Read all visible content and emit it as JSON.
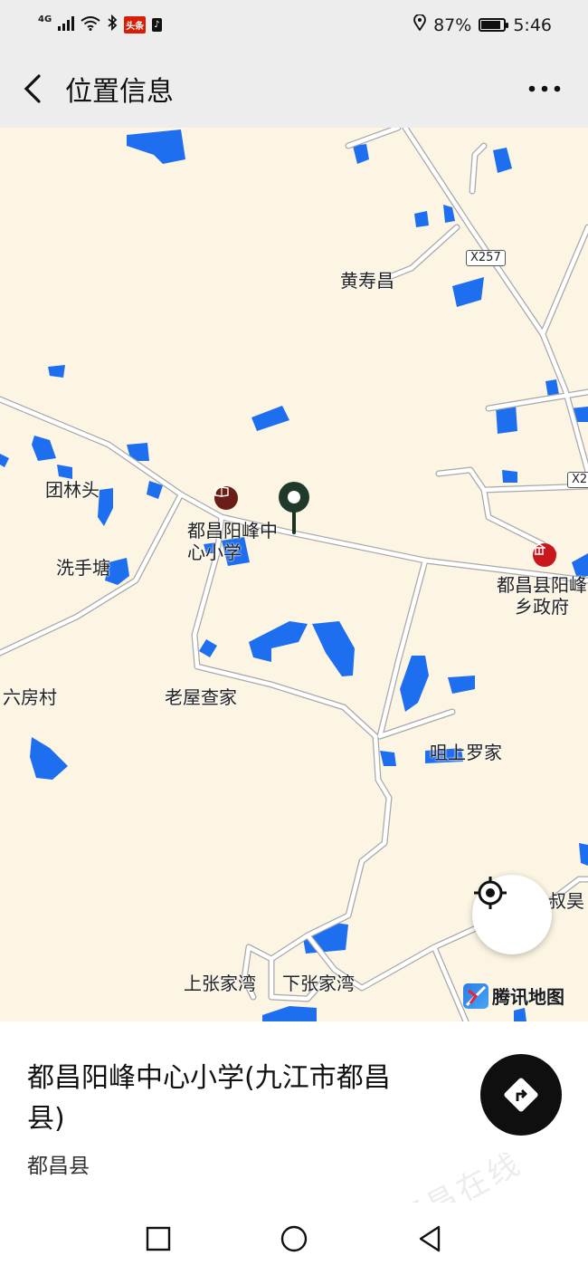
{
  "status": {
    "network": "4G",
    "app_badge_1": "头条",
    "app_badge_2": "♪",
    "battery": "87%",
    "time": "5:46"
  },
  "header": {
    "title": "位置信息"
  },
  "map": {
    "labels": {
      "huangshouchang": "黄寿昌",
      "tuanlintou": "团林头",
      "school": "都昌阳峰中心小学",
      "xishoutang": "洗手塘",
      "liufangcun": "六房村",
      "laowuchajia": "老屋查家",
      "gov": "都昌县阳峰乡政府",
      "zashangluojia": "咀上罗家",
      "shuhao": "叔昊",
      "shangzhangjiawan": "上张家湾",
      "xiazhangjiawan": "下张家湾"
    },
    "roads": {
      "x257": "X257",
      "x2_partial": "X2"
    },
    "provider": "腾讯地图"
  },
  "place": {
    "name": "都昌阳峰中心小学(九江市都昌县)",
    "region": "都昌县"
  },
  "watermark": "都昌在线",
  "colors": {
    "map_bg": "#fcf5e4",
    "water": "#1e6ef0",
    "road": "#ffffff",
    "pin": "#1f3a2b",
    "nav_button": "#0f0f0f"
  }
}
